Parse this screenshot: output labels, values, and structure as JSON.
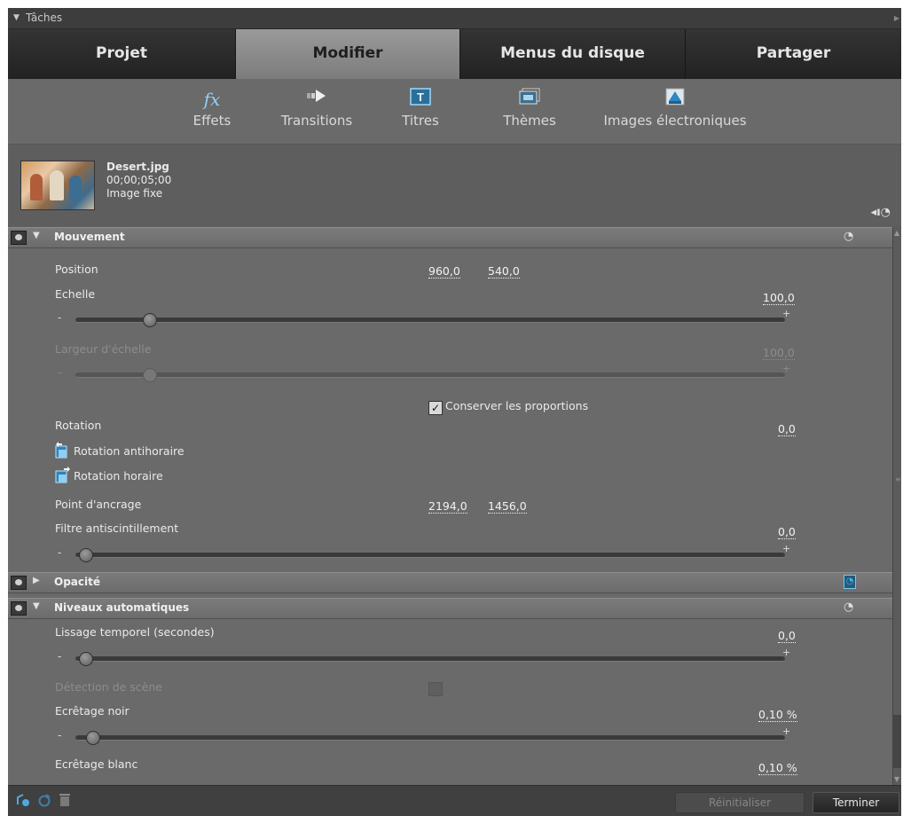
{
  "title_bar": {
    "label": "Tâches"
  },
  "tabs": [
    {
      "label": "Projet",
      "active": false
    },
    {
      "label": "Modifier",
      "active": true
    },
    {
      "label": "Menus du disque",
      "active": false
    },
    {
      "label": "Partager",
      "active": false
    }
  ],
  "toolbar": [
    {
      "label": "Effets",
      "icon": "fx-icon"
    },
    {
      "label": "Transitions",
      "icon": "transition-arrow-icon"
    },
    {
      "label": "Titres",
      "icon": "title-icon"
    },
    {
      "label": "Thèmes",
      "icon": "themes-icon"
    },
    {
      "label": "Images électroniques",
      "icon": "clip-art-icon"
    }
  ],
  "clip": {
    "name": "Desert.jpg",
    "duration": "00;00;05;00",
    "type": "Image fixe"
  },
  "sections": {
    "motion": {
      "label": "Mouvement",
      "expanded": true
    },
    "opacity": {
      "label": "Opacité",
      "expanded": false
    },
    "auto_levels": {
      "label": "Niveaux automatiques",
      "expanded": true
    }
  },
  "motion": {
    "position": {
      "label": "Position",
      "x": "960,0",
      "y": "540,0"
    },
    "scale": {
      "label": "Echelle",
      "value": "100,0",
      "slider_fraction": 0.09
    },
    "scale_width": {
      "label": "Largeur d'échelle",
      "value": "100,0",
      "slider_fraction": 0.09,
      "disabled": true
    },
    "keep_ratio": {
      "label": "Conserver les proportions",
      "checked": true
    },
    "rotation": {
      "label": "Rotation",
      "value": "0,0"
    },
    "rotate_ccw": {
      "label": "Rotation antihoraire"
    },
    "rotate_cw": {
      "label": "Rotation horaire"
    },
    "anchor": {
      "label": "Point d'ancrage",
      "x": "2194,0",
      "y": "1456,0"
    },
    "antiflicker": {
      "label": "Filtre antiscintillement",
      "value": "0,0",
      "slider_fraction": 0.0
    }
  },
  "auto_levels": {
    "temporal_smoothing": {
      "label": "Lissage temporel (secondes)",
      "value": "0,0",
      "slider_fraction": 0.0
    },
    "scene_detect": {
      "label": "Détection de scène",
      "checked": false,
      "disabled": true
    },
    "black_clip": {
      "label": "Ecrêtage noir",
      "value": "0,10 %",
      "slider_fraction": 0.01
    },
    "white_clip": {
      "label": "Ecrêtage blanc",
      "value": "0,10 %"
    }
  },
  "slider_min": "-",
  "slider_max": "+",
  "footer": {
    "reset_label": "Réinitialiser",
    "done_label": "Terminer"
  },
  "colors": {
    "panel_bg": "#6b6b6b",
    "active_tab": "#8c8c8c",
    "tab_bg": "#2b2b2b",
    "accent_blue": "#4fb5e9"
  }
}
